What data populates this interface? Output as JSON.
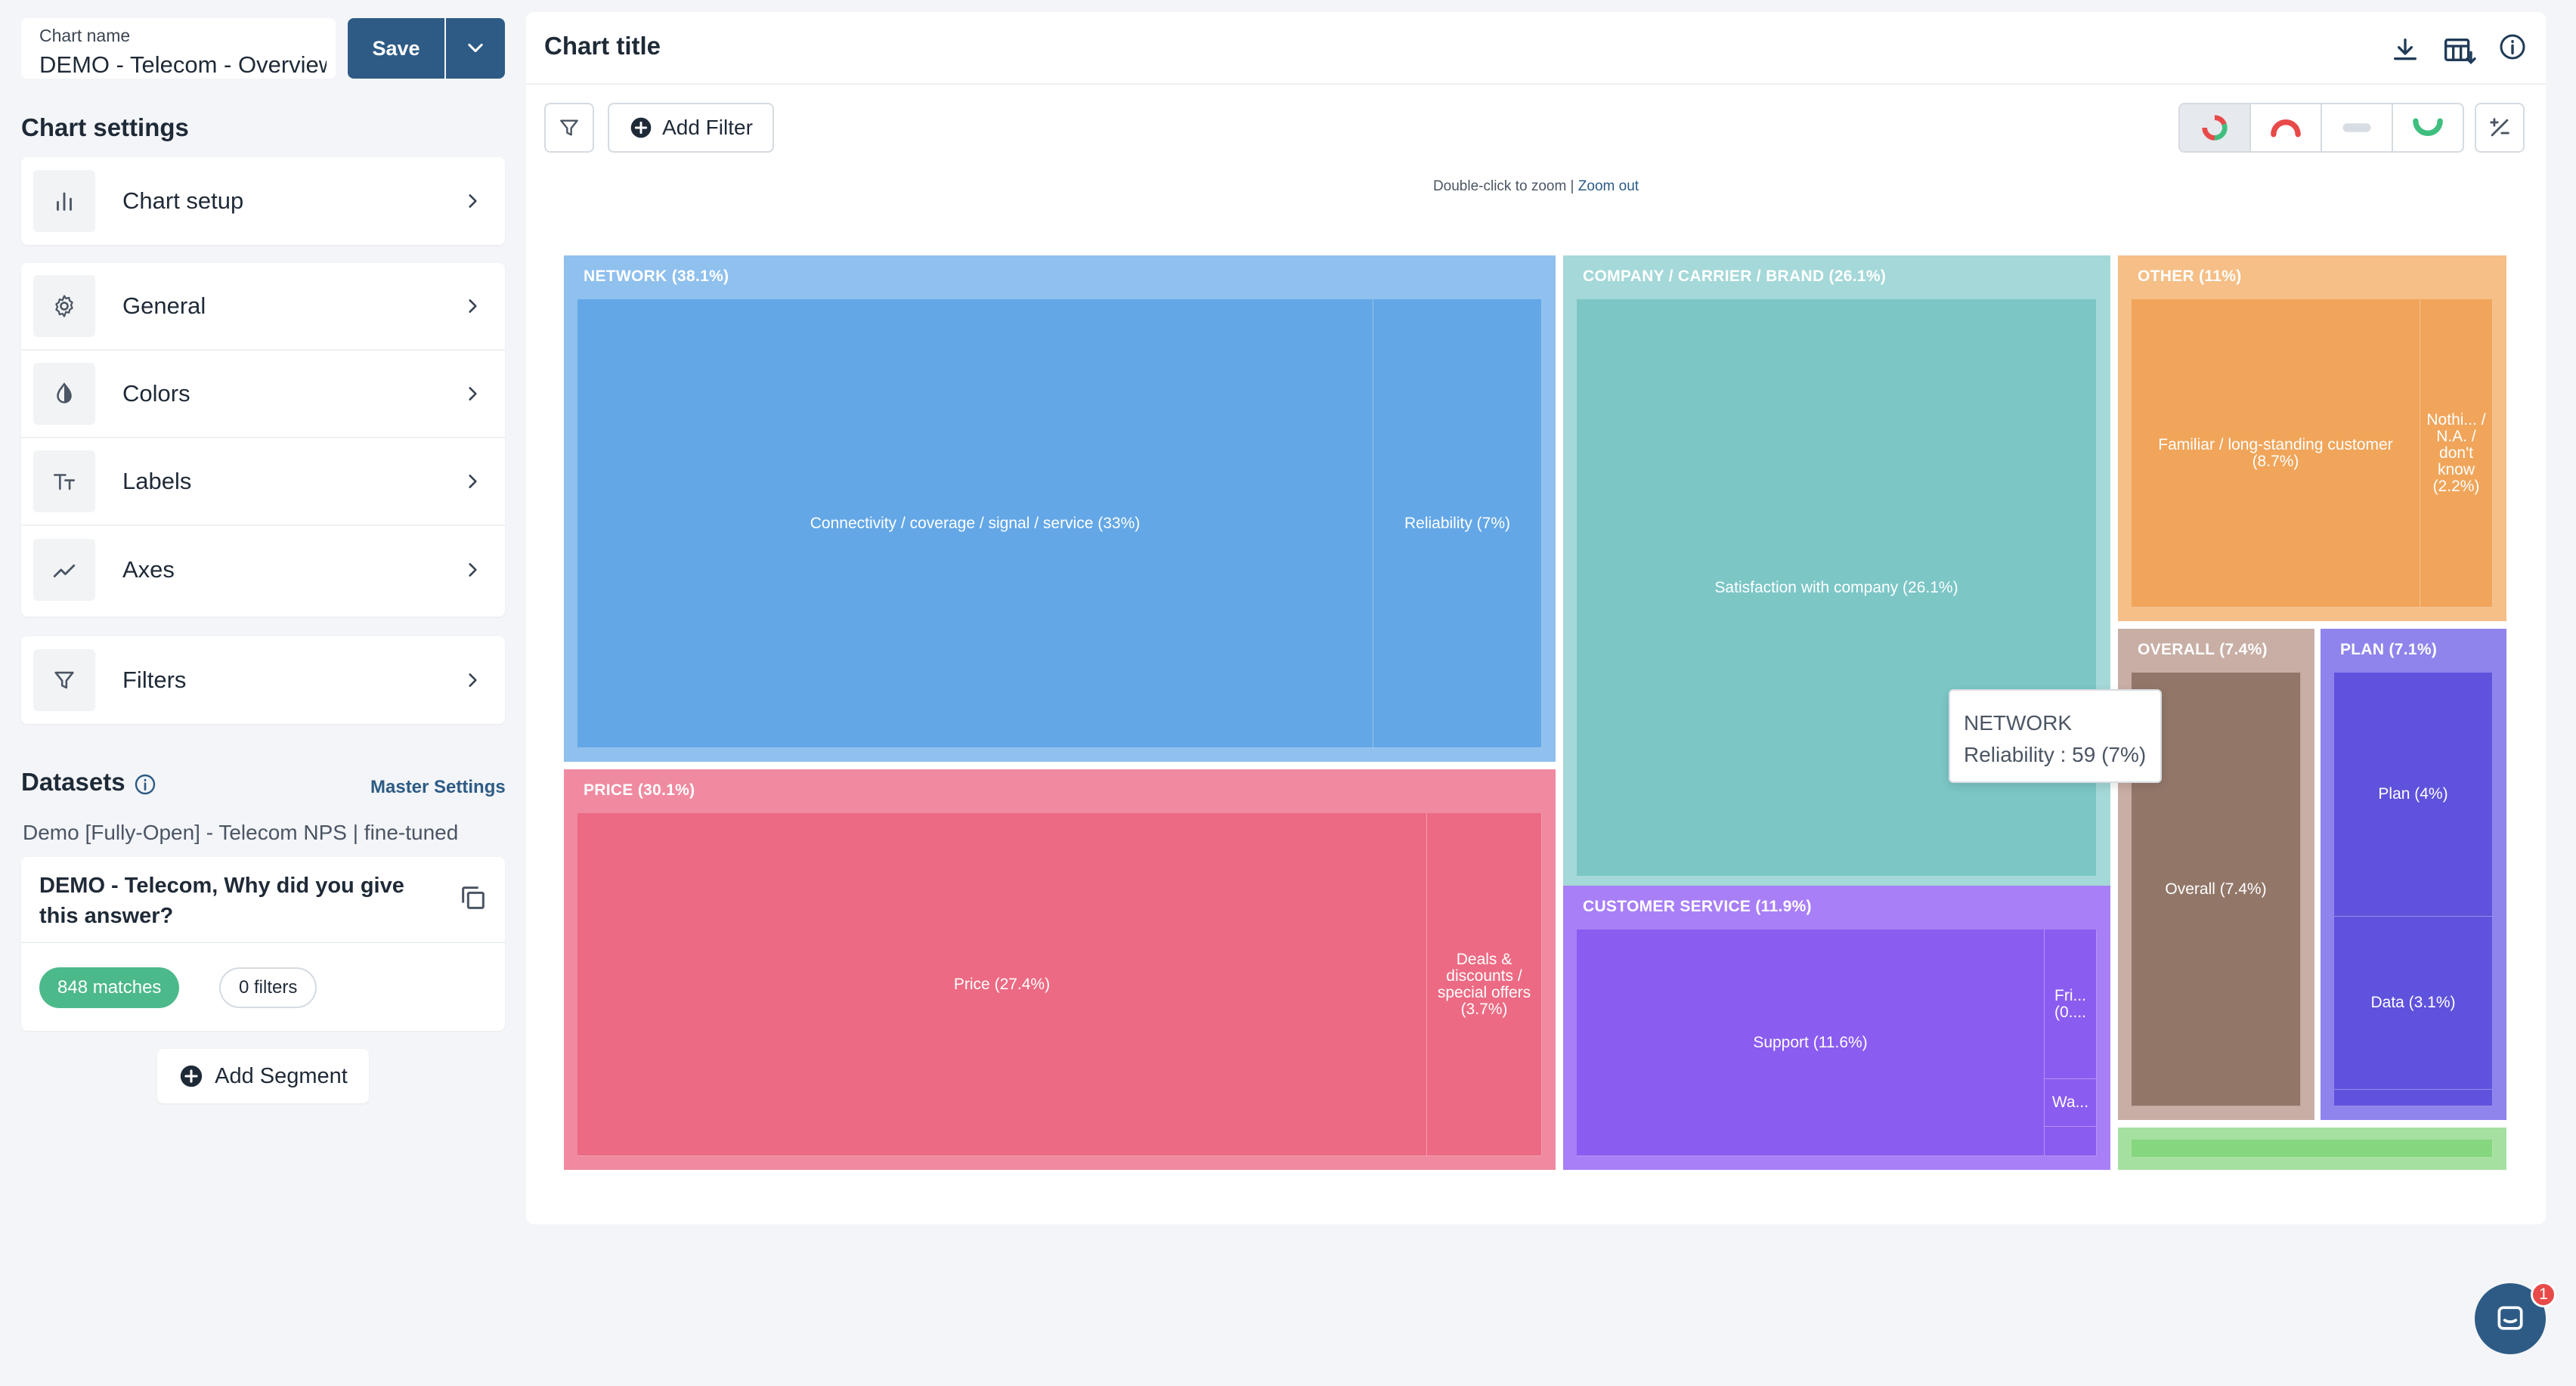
{
  "chart_name": {
    "label": "Chart name",
    "value": "DEMO - Telecom - Overview"
  },
  "actions": {
    "save_label": "Save"
  },
  "chart_settings": {
    "title": "Chart settings",
    "items": [
      {
        "label": "Chart setup",
        "icon": "bar-chart-icon"
      },
      {
        "label": "General",
        "icon": "gear-icon"
      },
      {
        "label": "Colors",
        "icon": "droplet-icon"
      },
      {
        "label": "Labels",
        "icon": "text-size-icon"
      },
      {
        "label": "Axes",
        "icon": "trend-line-icon"
      },
      {
        "label": "Filters",
        "icon": "funnel-icon"
      }
    ]
  },
  "datasets": {
    "title": "Datasets",
    "master_settings": "Master Settings",
    "dataset_name": "Demo [Fully-Open] - Telecom NPS | fine-tuned",
    "question": "DEMO - Telecom, Why did you give this answer?",
    "matches": "848 matches",
    "filters": "0 filters",
    "add_segment": "Add Segment"
  },
  "chart_header": {
    "title": "Chart title"
  },
  "toolbar": {
    "add_filter": "Add Filter"
  },
  "zoom": {
    "hint": "Double-click to zoom |",
    "zoom_out": "Zoom out"
  },
  "tooltip": {
    "group": "NETWORK",
    "detail": "Reliability : 59 (7%)"
  },
  "chat": {
    "badge": "1"
  },
  "chart_data": {
    "type": "treemap",
    "groups": [
      {
        "name": "NETWORK (38.1%)",
        "value": 38.1,
        "color": "#8fc0ee",
        "leaf_color": "#63a7e6",
        "children": [
          {
            "name": "Connectivity / coverage / signal / service (33%)",
            "value": 33
          },
          {
            "name": "Reliability (7%)",
            "value": 7
          }
        ]
      },
      {
        "name": "PRICE (30.1%)",
        "value": 30.1,
        "color": "#f08aa0",
        "leaf_color": "#ec6a83",
        "children": [
          {
            "name": "Price (27.4%)",
            "value": 27.4
          },
          {
            "name": "Deals & discounts / special offers (3.7%)",
            "value": 3.7
          }
        ]
      },
      {
        "name": "COMPANY / CARRIER / BRAND (26.1%)",
        "value": 26.1,
        "color": "#a5d8d8",
        "leaf_color": "#7cc6c6",
        "children": [
          {
            "name": "Satisfaction with company (26.1%)",
            "value": 26.1
          }
        ]
      },
      {
        "name": "CUSTOMER SERVICE (11.9%)",
        "value": 11.9,
        "color": "#a97ff7",
        "leaf_color": "#8b5cf0",
        "children": [
          {
            "name": "Support (11.6%)",
            "value": 11.6
          },
          {
            "name": "Fri... (0....",
            "value": 0.2
          },
          {
            "name": "Wa...",
            "value": 0.1
          }
        ]
      },
      {
        "name": "OTHER (11%)",
        "value": 11,
        "color": "#f5bf87",
        "leaf_color": "#f0a55a",
        "children": [
          {
            "name": "Familiar / long-standing customer (8.7%)",
            "value": 8.7
          },
          {
            "name": "Nothi... / N.A. / don't know (2.2%)",
            "value": 2.2
          }
        ]
      },
      {
        "name": "OVERALL (7.4%)",
        "value": 7.4,
        "color": "#c8aea5",
        "leaf_color": "#927769",
        "children": [
          {
            "name": "Overall (7.4%)",
            "value": 7.4
          }
        ]
      },
      {
        "name": "PLAN (7.1%)",
        "value": 7.1,
        "color": "#8f84ec",
        "leaf_color": "#5f52dc",
        "children": [
          {
            "name": "Plan (4%)",
            "value": 4
          },
          {
            "name": "Data (3.1%)",
            "value": 3.1
          }
        ]
      },
      {
        "name": "",
        "value": 0.5,
        "color": "#a6e0a0",
        "leaf_color": "#86d57f",
        "children": [
          {
            "name": "",
            "value": 0.5
          }
        ]
      }
    ]
  }
}
